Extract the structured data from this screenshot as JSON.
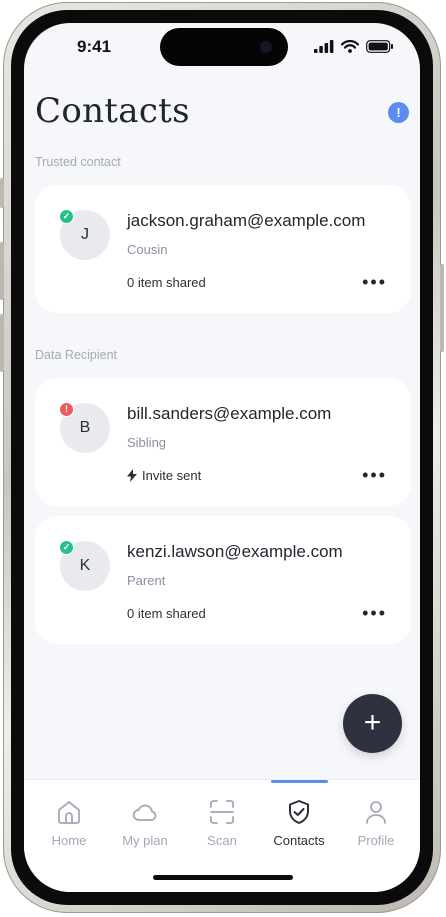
{
  "status_bar": {
    "time": "9:41"
  },
  "header": {
    "title": "Contacts",
    "alert_icon": "info-icon",
    "alert_symbol": "!"
  },
  "sections": [
    {
      "label": "Trusted contact",
      "contacts": [
        {
          "initial": "J",
          "email": "jackson.graham@example.com",
          "relation": "Cousin",
          "status": "verified",
          "meta": "0 item shared"
        }
      ]
    },
    {
      "label": "Data Recipient",
      "contacts": [
        {
          "initial": "B",
          "email": "bill.sanders@example.com",
          "relation": "Sibling",
          "status": "pending",
          "meta": "Invite sent"
        },
        {
          "initial": "K",
          "email": "kenzi.lawson@example.com",
          "relation": "Parent",
          "status": "verified",
          "meta": "0 item shared"
        }
      ]
    }
  ],
  "more_symbol": "•••",
  "fab": {
    "symbol": "+"
  },
  "tab_bar": {
    "active": "Contacts",
    "tabs": [
      {
        "label": "Home",
        "icon": "home-icon"
      },
      {
        "label": "My plan",
        "icon": "cloud-icon"
      },
      {
        "label": "Scan",
        "icon": "scan-icon"
      },
      {
        "label": "Contacts",
        "icon": "shield-check-icon"
      },
      {
        "label": "Profile",
        "icon": "user-icon"
      }
    ]
  },
  "colors": {
    "accent": "#5b8def",
    "verified": "#27c08a",
    "pending": "#ee5b5b",
    "fab": "#2e3240",
    "background": "#f6f7fb"
  }
}
